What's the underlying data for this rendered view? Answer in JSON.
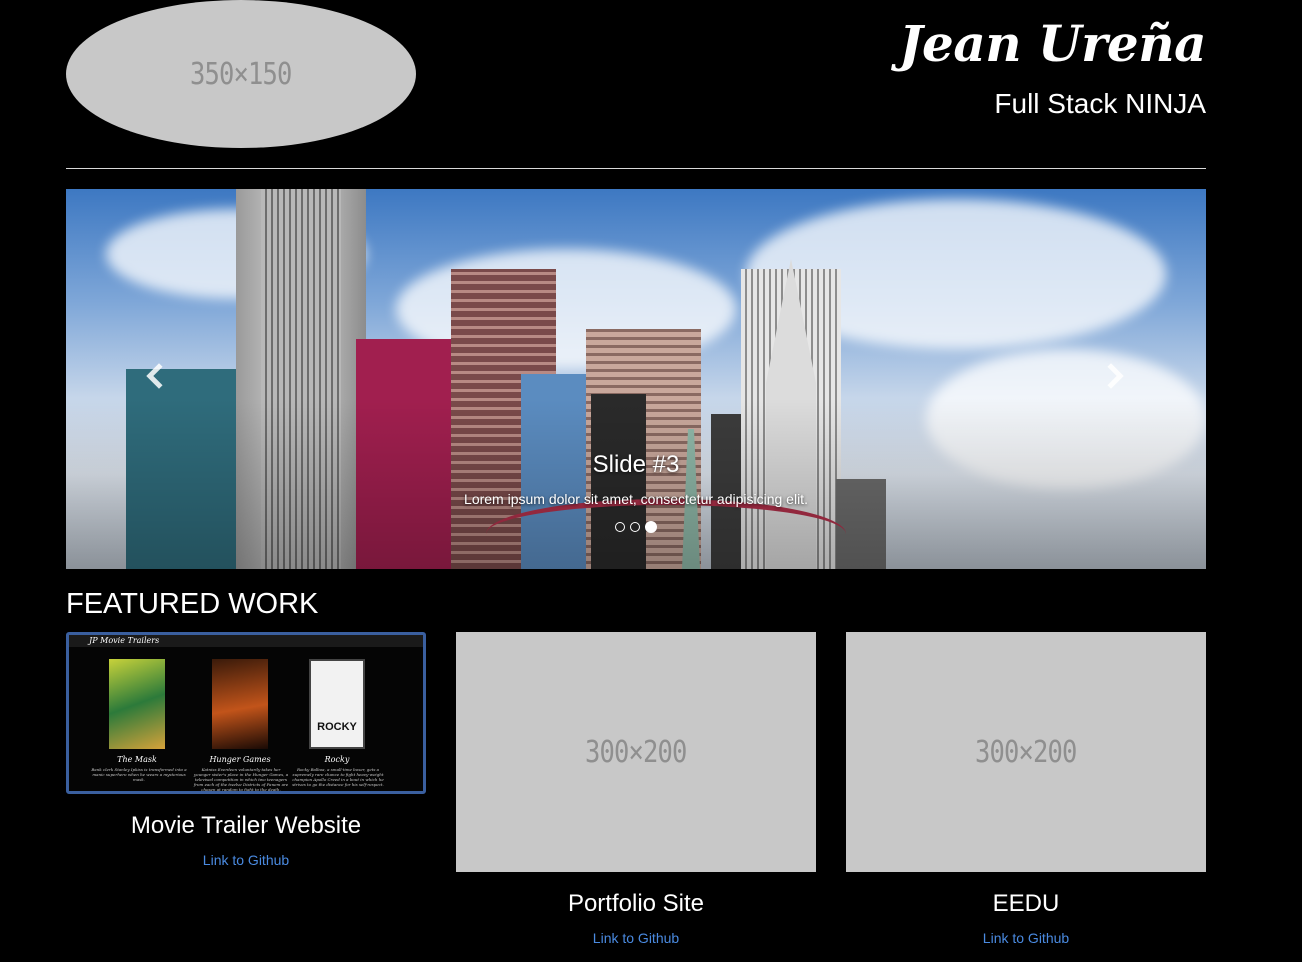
{
  "header": {
    "logo_placeholder": "350×150",
    "name": "Jean Ureña",
    "tagline": "Full Stack NINJA"
  },
  "carousel": {
    "caption_title": "Slide #3",
    "caption_text": "Lorem ipsum dolor sit amet, consectetur adipisicing elit.",
    "slide_count": 3,
    "active_slide": 3
  },
  "featured": {
    "heading": "FEATURED WORK",
    "items": [
      {
        "title": "Movie Trailer Website",
        "link": "Link to Github",
        "preview": {
          "site_title": "JP Movie Trailers",
          "movies": [
            {
              "name": "The Mask",
              "desc": "Bank clerk Stanley Ipkiss is transformed into a manic superhero when he wears a mysterious mask."
            },
            {
              "name": "Hunger Games",
              "desc": "Katniss Everdeen voluntarily takes her younger sister's place in the Hunger Games, a televised competition in which two teenagers from each of the twelve Districts of Panem are chosen at random to fight to the death."
            },
            {
              "name": "Rocky",
              "desc": "Rocky Balboa, a small-time boxer, gets a supremely rare chance to fight heavy-weight champion Apollo Creed in a bout in which he strives to go the distance for his self-respect."
            }
          ],
          "poster_text": "ROCKY"
        }
      },
      {
        "title": "Portfolio Site",
        "link": "Link to Github",
        "placeholder": "300×200"
      },
      {
        "title": "EEDU",
        "link": "Link to Github",
        "placeholder": "300×200"
      }
    ]
  },
  "colors": {
    "background": "#000000",
    "placeholder": "#c8c8c8",
    "link": "#4a8ae0"
  }
}
